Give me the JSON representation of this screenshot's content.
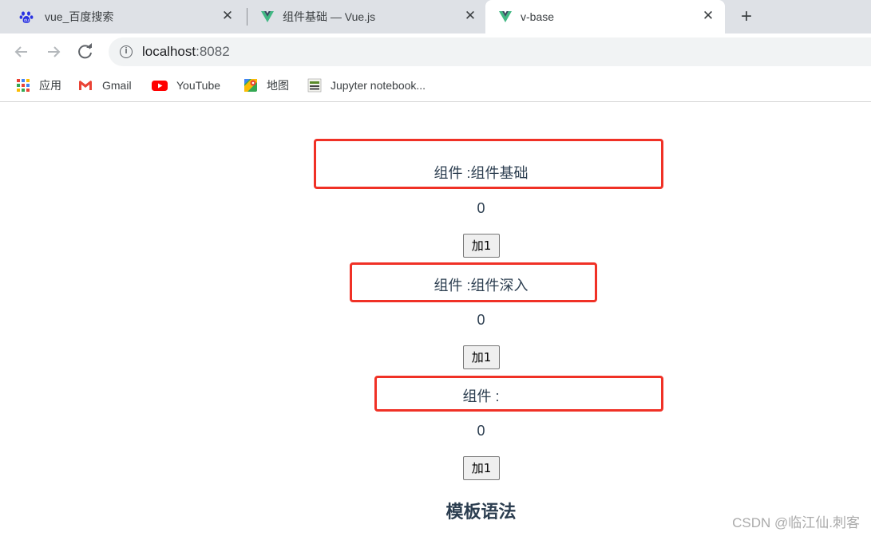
{
  "browser": {
    "tabs": [
      {
        "title": "vue_百度搜索",
        "favicon": "baidu-paw-icon"
      },
      {
        "title": "组件基础 — Vue.js",
        "favicon": "vue-logo-icon"
      },
      {
        "title": "v-base",
        "favicon": "vue-logo-icon",
        "active": true
      }
    ],
    "close_glyph": "✕",
    "new_tab_glyph": "+",
    "url_host": "localhost",
    "url_port": ":8082",
    "bookmarks": [
      {
        "label": "应用",
        "icon": "apps-grid-icon"
      },
      {
        "label": "Gmail",
        "icon": "gmail-icon"
      },
      {
        "label": "YouTube",
        "icon": "youtube-icon"
      },
      {
        "label": "地图",
        "icon": "maps-icon"
      },
      {
        "label": "Jupyter notebook...",
        "icon": "jupyter-icon"
      }
    ]
  },
  "page": {
    "components": [
      {
        "title": "组件 :组件基础",
        "count": "0",
        "button": "加1"
      },
      {
        "title": "组件 :组件深入",
        "count": "0",
        "button": "加1"
      },
      {
        "title": "组件 :",
        "count": "0",
        "button": "加1"
      }
    ],
    "heading": "模板语法",
    "watermark": "CSDN @临江仙.刺客"
  },
  "colors": {
    "highlight_border": "#f03126",
    "text": "#2c3e50",
    "vue_green": "#41b883"
  }
}
